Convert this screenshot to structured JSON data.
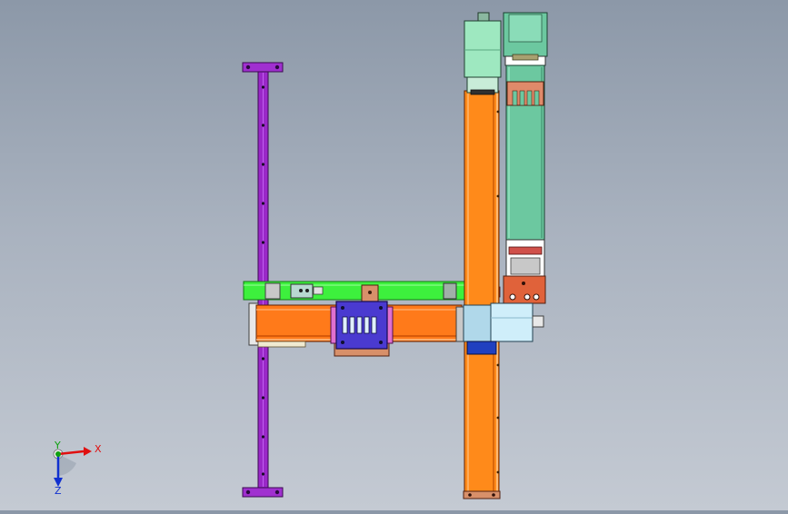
{
  "viewport": {
    "name": "cad-3d-viewport"
  },
  "triad": {
    "x_label": "X",
    "y_label": "Y",
    "z_label": "Z",
    "x_color": "#e01010",
    "y_color": "#10a010",
    "z_color": "#1030d0"
  },
  "colors": {
    "background_top": "#8c98a8",
    "background_bottom": "#c4cad3",
    "purple_rail": "#9a28c8",
    "orange_beam": "#ff7a1a",
    "green_cover": "#3df03d",
    "teal_cover": "#6cc8a0",
    "mint_motor": "#9ee8c0",
    "blue_slider": "#4a3ad0",
    "copper_plate": "#d88060"
  }
}
